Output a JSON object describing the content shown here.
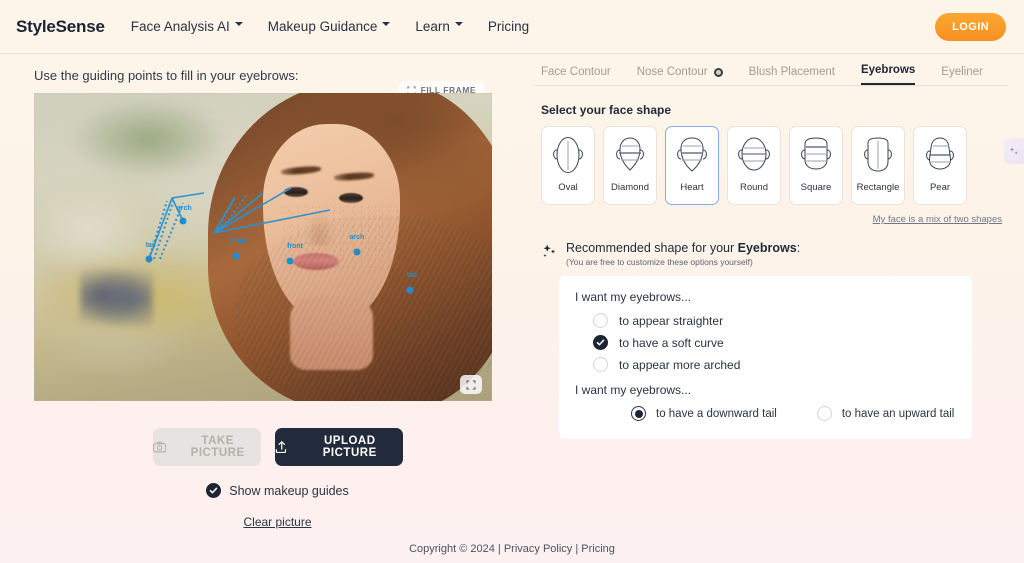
{
  "header": {
    "brand": "StyleSense",
    "nav": [
      {
        "label": "Face Analysis AI",
        "has_caret": true
      },
      {
        "label": "Makeup Guidance",
        "has_caret": true
      },
      {
        "label": "Learn",
        "has_caret": true
      },
      {
        "label": "Pricing",
        "has_caret": false
      }
    ],
    "login_label": "LOGIN",
    "login_color": "#f79020"
  },
  "left": {
    "prompt": "Use the guiding points to fill in your eyebrows:",
    "fill_frame_label": "FILL FRAME",
    "take_picture_label": "TAKE PICTURE",
    "upload_picture_label": "UPLOAD PICTURE",
    "show_guides_label": "Show makeup guides",
    "show_guides_checked": true,
    "clear_picture_label": "Clear picture",
    "guide_points": [
      {
        "label": "tail",
        "x": 25.2,
        "y": 54.0
      },
      {
        "label": "arch",
        "x": 32.5,
        "y": 41.5
      },
      {
        "label": "front",
        "x": 44.0,
        "y": 53.0
      },
      {
        "label": "front",
        "x": 56.0,
        "y": 54.5
      },
      {
        "label": "arch",
        "x": 70.5,
        "y": 51.5
      },
      {
        "label": "tail",
        "x": 82.0,
        "y": 64.0
      }
    ],
    "guide_accent": "#2b93d1"
  },
  "right": {
    "tabs": [
      {
        "label": "Face Contour",
        "active": false,
        "icon": null
      },
      {
        "label": "Nose Contour",
        "active": false,
        "icon": "target-icon"
      },
      {
        "label": "Blush Placement",
        "active": false,
        "icon": null
      },
      {
        "label": "Eyebrows",
        "active": true,
        "icon": null
      },
      {
        "label": "Eyeliner",
        "active": false,
        "icon": null
      }
    ],
    "face_shape_title": "Select your face shape",
    "face_shapes": [
      {
        "label": "Oval",
        "selected": false
      },
      {
        "label": "Diamond",
        "selected": false
      },
      {
        "label": "Heart",
        "selected": true
      },
      {
        "label": "Round",
        "selected": false
      },
      {
        "label": "Square",
        "selected": false
      },
      {
        "label": "Rectangle",
        "selected": false
      },
      {
        "label": "Pear",
        "selected": false
      }
    ],
    "selected_shape_border": "#8aa9e8",
    "mix_link": "My face is a mix of two shapes",
    "recommend": {
      "prefix": "Recommended shape for your ",
      "feature": "Eyebrows",
      "suffix": ":",
      "note": "(You are free to customize these options yourself)"
    },
    "options": {
      "curve_heading": "I want my eyebrows...",
      "curve_choices": [
        {
          "label": "to appear straighter",
          "checked": false
        },
        {
          "label": "to have a soft curve",
          "checked": true
        },
        {
          "label": "to appear more arched",
          "checked": false
        }
      ],
      "tail_heading": "I want my eyebrows...",
      "tail_choices": [
        {
          "label": "to have a downward tail",
          "selected": true
        },
        {
          "label": "to have an upward tail",
          "selected": false
        }
      ]
    }
  },
  "footer": {
    "copyright": "Copyright © 2024",
    "sep1": "|",
    "privacy": "Privacy Policy",
    "sep2": "|",
    "pricing": "Pricing"
  }
}
